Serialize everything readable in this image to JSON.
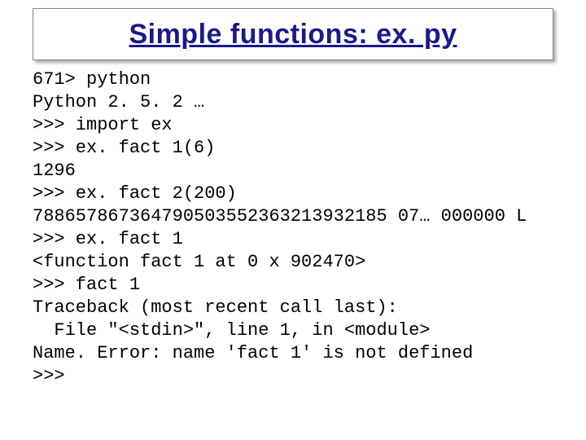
{
  "title": "Simple functions: ex. py",
  "code": {
    "l01": "671> python",
    "l02": "Python 2. 5. 2 …",
    "l03": ">>> import ex",
    "l04": ">>> ex. fact 1(6)",
    "l05": "1296",
    "l06": ">>> ex. fact 2(200)",
    "l07": "788657867364790503552363213932185 07… 000000 L",
    "l08": ">>> ex. fact 1",
    "l09": "<function fact 1 at 0 x 902470>",
    "l10": ">>> fact 1",
    "l11": "Traceback (most recent call last):",
    "l12": "  File \"<stdin>\", line 1, in <module>",
    "l13": "Name. Error: name 'fact 1' is not defined",
    "l14": ">>>"
  }
}
